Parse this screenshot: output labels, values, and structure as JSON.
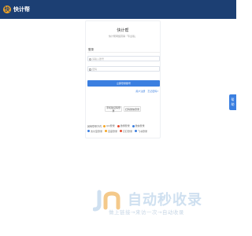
{
  "header": {
    "logo_char": "快",
    "app_name": "快计帮"
  },
  "login": {
    "title": "快计帮",
    "subtitle": "快计帮网络营销「专业版」",
    "tab_label": "登录",
    "username_placeholder": "请输入账号",
    "password_placeholder": "密码",
    "submit_label": "立即登录账号",
    "register_link": "用户注册",
    "forgot_link": "忘记密码?",
    "alt_buttons": [
      "手机验证码登录",
      "扫码微信登录"
    ],
    "other_label": "其他登录方式:",
    "other_methods": [
      {
        "label": "QQ登录",
        "color": "#f5a623"
      },
      {
        "label": "微博登录",
        "color": "#e64a2e"
      },
      {
        "label": "微信登录",
        "color": "#3b7fe0"
      },
      {
        "label": "支付宝登录",
        "color": "#3b7fe0"
      },
      {
        "label": "百度登录",
        "color": "#f5a623"
      },
      {
        "label": "钉钉登录",
        "color": "#e64a2e"
      },
      {
        "label": "飞书登录",
        "color": "#3b7fe0"
      }
    ]
  },
  "side_tab": {
    "chars": [
      "帮",
      "助"
    ]
  },
  "watermark": {
    "title": "自动秒收录",
    "subtitle": "做上链接→来访一次→自动收录"
  }
}
